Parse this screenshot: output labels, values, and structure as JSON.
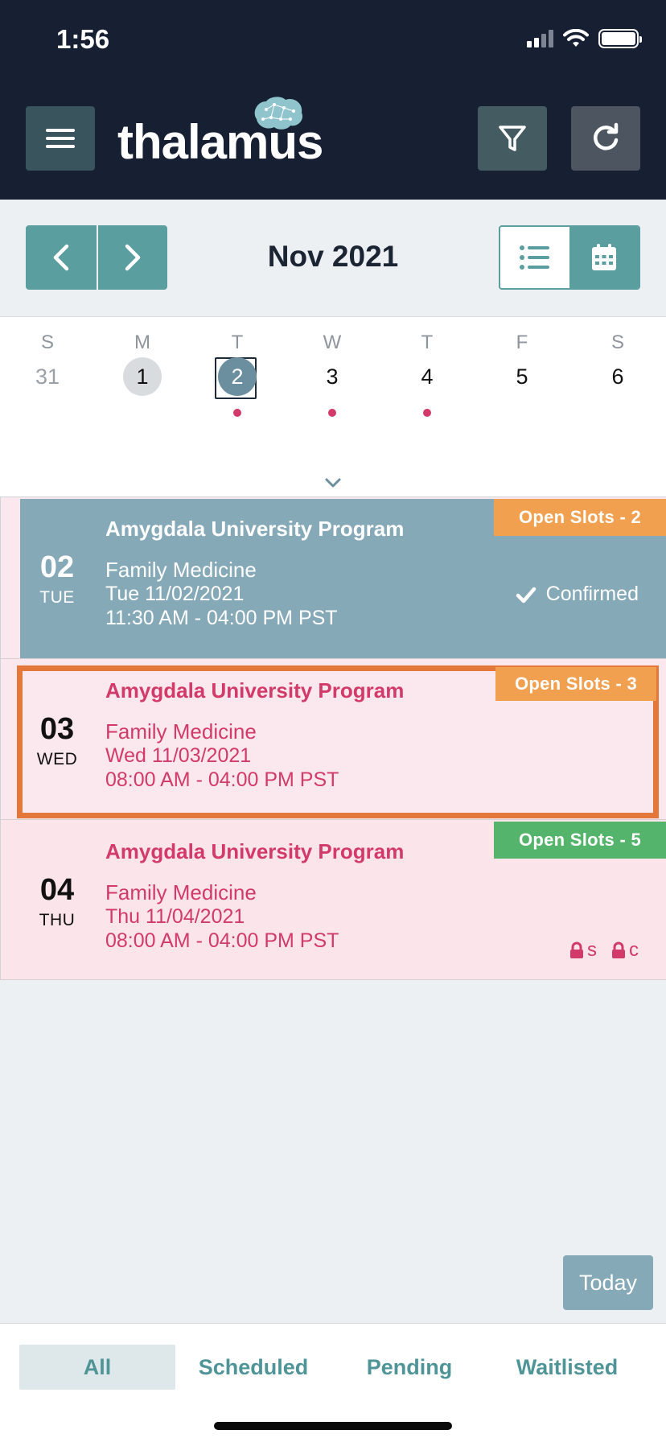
{
  "status_bar": {
    "time": "1:56"
  },
  "header": {
    "logo_text": "thalamus"
  },
  "month_nav": {
    "title": "Nov 2021"
  },
  "week": {
    "days": [
      {
        "dow": "S",
        "num": "31",
        "state": "muted",
        "dot": false
      },
      {
        "dow": "M",
        "num": "1",
        "state": "today",
        "dot": false
      },
      {
        "dow": "T",
        "num": "2",
        "state": "selected",
        "dot": true
      },
      {
        "dow": "W",
        "num": "3",
        "state": "normal",
        "dot": true
      },
      {
        "dow": "T",
        "num": "4",
        "state": "normal",
        "dot": true
      },
      {
        "dow": "F",
        "num": "5",
        "state": "normal",
        "dot": false
      },
      {
        "dow": "S",
        "num": "6",
        "state": "normal",
        "dot": false
      }
    ]
  },
  "events": [
    {
      "day_num": "02",
      "day_abbr": "TUE",
      "program": "Amygdala University Program",
      "specialty": "Family Medicine",
      "date": "Tue 11/02/2021",
      "time": "11:30 AM - 04:00 PM PST",
      "slots": "Open Slots - 2",
      "status": "Confirmed"
    },
    {
      "day_num": "03",
      "day_abbr": "WED",
      "program": "Amygdala University Program",
      "specialty": "Family Medicine",
      "date": "Wed 11/03/2021",
      "time": "08:00 AM - 04:00 PM PST",
      "slots": "Open Slots - 3"
    },
    {
      "day_num": "04",
      "day_abbr": "THU",
      "program": "Amygdala University Program",
      "specialty": "Family Medicine",
      "date": "Thu 11/04/2021",
      "time": "08:00 AM - 04:00 PM PST",
      "slots": "Open Slots - 5",
      "locks": [
        "s",
        "c"
      ]
    }
  ],
  "today_button": "Today",
  "tabs": [
    {
      "label": "All",
      "active": true
    },
    {
      "label": "Scheduled",
      "active": false
    },
    {
      "label": "Pending",
      "active": false
    },
    {
      "label": "Waitlisted",
      "active": false
    }
  ],
  "colors": {
    "header_bg": "#162032",
    "accent_teal": "#5b9ea0",
    "confirmed_card": "#86a9b8",
    "pink_text": "#d23a6a",
    "badge_orange": "#f0a04f",
    "badge_green": "#55b46c",
    "highlight_outline": "#e4773a"
  }
}
